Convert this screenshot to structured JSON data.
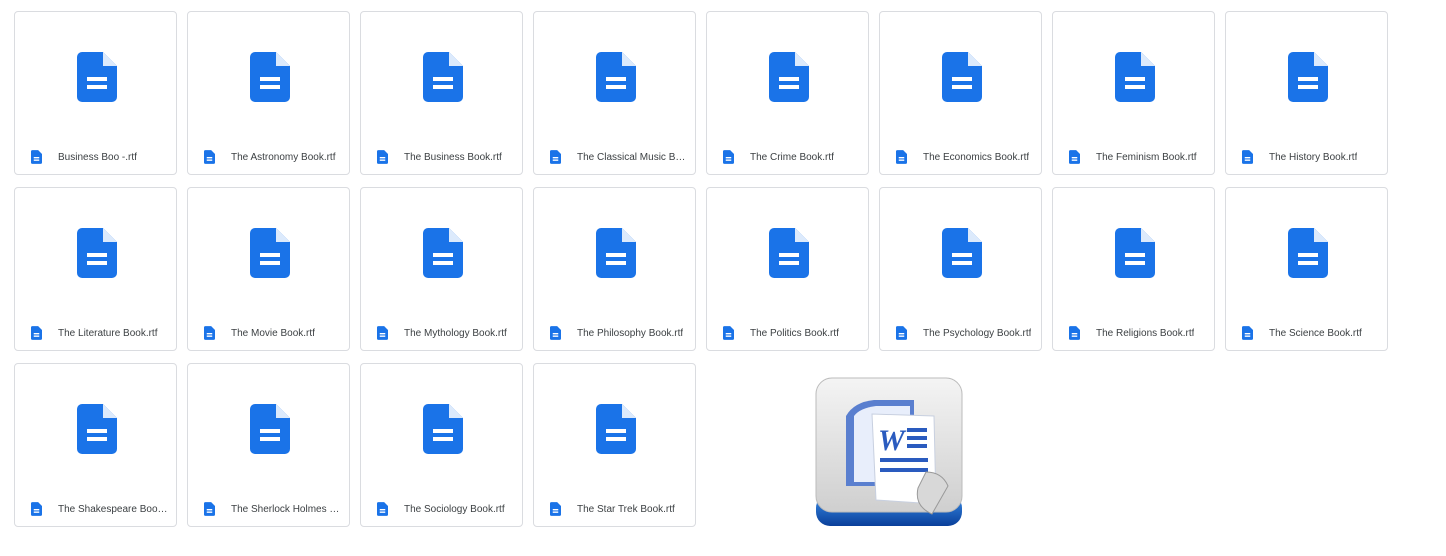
{
  "files": [
    {
      "name": "Business Boo -.rtf"
    },
    {
      "name": "The Astronomy Book.rtf"
    },
    {
      "name": "The Business Book.rtf"
    },
    {
      "name": "The Classical Music Bo..."
    },
    {
      "name": "The Crime Book.rtf"
    },
    {
      "name": "The Economics Book.rtf"
    },
    {
      "name": "The Feminism Book.rtf"
    },
    {
      "name": "The History Book.rtf"
    },
    {
      "name": "The Literature Book.rtf"
    },
    {
      "name": "The Movie Book.rtf"
    },
    {
      "name": "The Mythology Book.rtf"
    },
    {
      "name": "The Philosophy Book.rtf"
    },
    {
      "name": "The Politics Book.rtf"
    },
    {
      "name": "The Psychology Book.rtf"
    },
    {
      "name": "The Religions Book.rtf"
    },
    {
      "name": "The Science Book.rtf"
    },
    {
      "name": "The Shakespeare Book...."
    },
    {
      "name": "The Sherlock Holmes B..."
    },
    {
      "name": "The Sociology Book.rtf"
    },
    {
      "name": "The Star Trek Book.rtf"
    }
  ],
  "icon": "google-docs-icon",
  "accent": "#1a73e8",
  "logo": {
    "text": "W",
    "name": "microsoft-word-logo"
  }
}
